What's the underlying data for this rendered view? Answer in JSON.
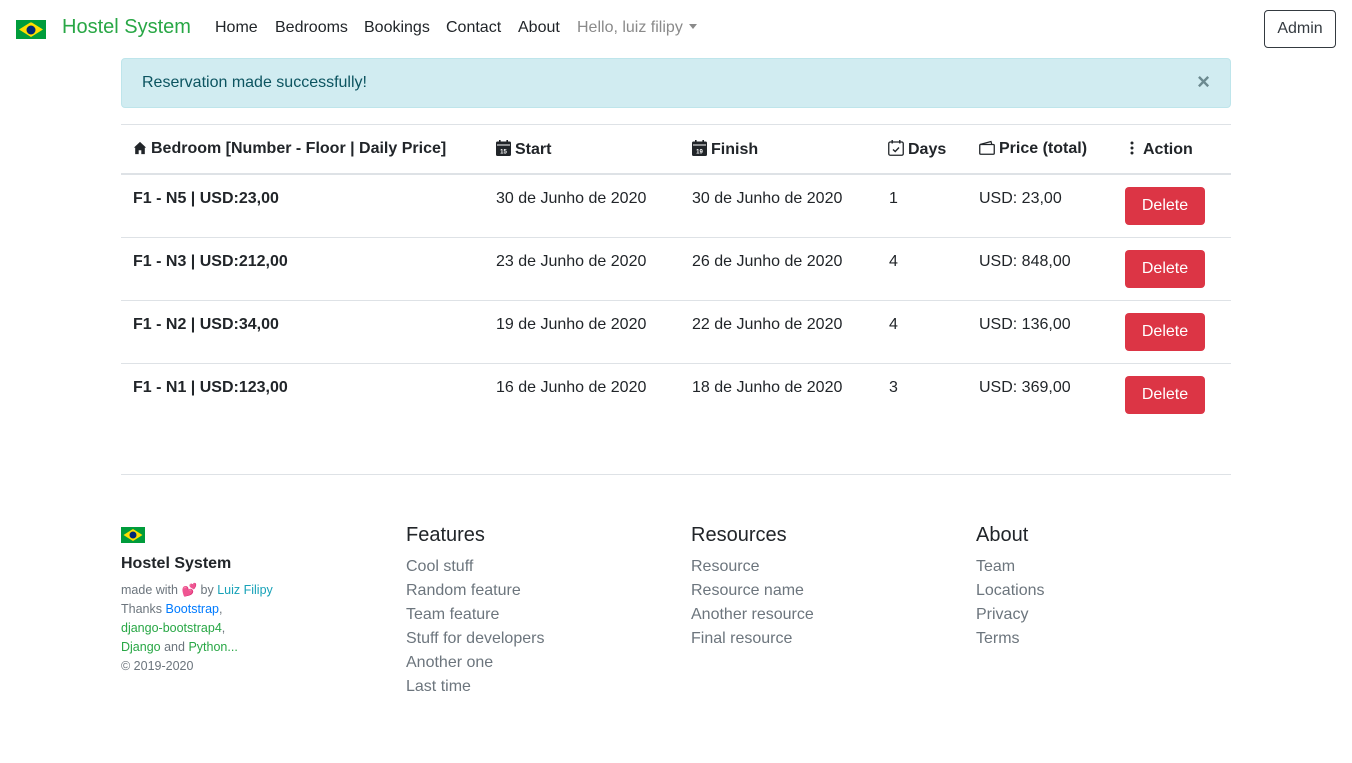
{
  "navbar": {
    "brand": "Hostel System",
    "links": [
      "Home",
      "Bedrooms",
      "Bookings",
      "Contact",
      "About"
    ],
    "user": "Hello, luiz filipy",
    "admin_label": "Admin"
  },
  "alert": {
    "message": "Reservation made successfully!",
    "close_symbol": "×"
  },
  "table": {
    "headers": [
      "Bedroom [Number - Floor | Daily Price]",
      "Start",
      "Finish",
      "Days",
      "Price (total)",
      "Action"
    ],
    "rows": [
      {
        "bedroom": "F1 - N5 | USD:23,00",
        "start": "30 de Junho de 2020",
        "finish": "30 de Junho de 2020",
        "days": "1",
        "price": "USD: 23,00",
        "action": "Delete"
      },
      {
        "bedroom": "F1 - N3 | USD:212,00",
        "start": "23 de Junho de 2020",
        "finish": "26 de Junho de 2020",
        "days": "4",
        "price": "USD: 848,00",
        "action": "Delete"
      },
      {
        "bedroom": "F1 - N2 | USD:34,00",
        "start": "19 de Junho de 2020",
        "finish": "22 de Junho de 2020",
        "days": "4",
        "price": "USD: 136,00",
        "action": "Delete"
      },
      {
        "bedroom": "F1 - N1 | USD:123,00",
        "start": "16 de Junho de 2020",
        "finish": "18 de Junho de 2020",
        "days": "3",
        "price": "USD: 369,00",
        "action": "Delete"
      }
    ]
  },
  "footer": {
    "brand": "Hostel System",
    "made_with": "made with",
    "heart": "💕",
    "by": "by",
    "author": "Luiz Filipy",
    "thanks": "Thanks",
    "bootstrap": "Bootstrap",
    "django_bootstrap": "django-bootstrap4",
    "django": "Django",
    "and": "and",
    "python": "Python...",
    "copyright": "© 2019-2020",
    "columns": [
      {
        "title": "Features",
        "links": [
          "Cool stuff",
          "Random feature",
          "Team feature",
          "Stuff for developers",
          "Another one",
          "Last time"
        ]
      },
      {
        "title": "Resources",
        "links": [
          "Resource",
          "Resource name",
          "Another resource",
          "Final resource"
        ]
      },
      {
        "title": "About",
        "links": [
          "Team",
          "Locations",
          "Privacy",
          "Terms"
        ]
      }
    ]
  },
  "colors": {
    "brand": "#28a745",
    "danger": "#dc3545",
    "alert_bg": "#d1ecf1",
    "alert_text": "#0c5460"
  }
}
